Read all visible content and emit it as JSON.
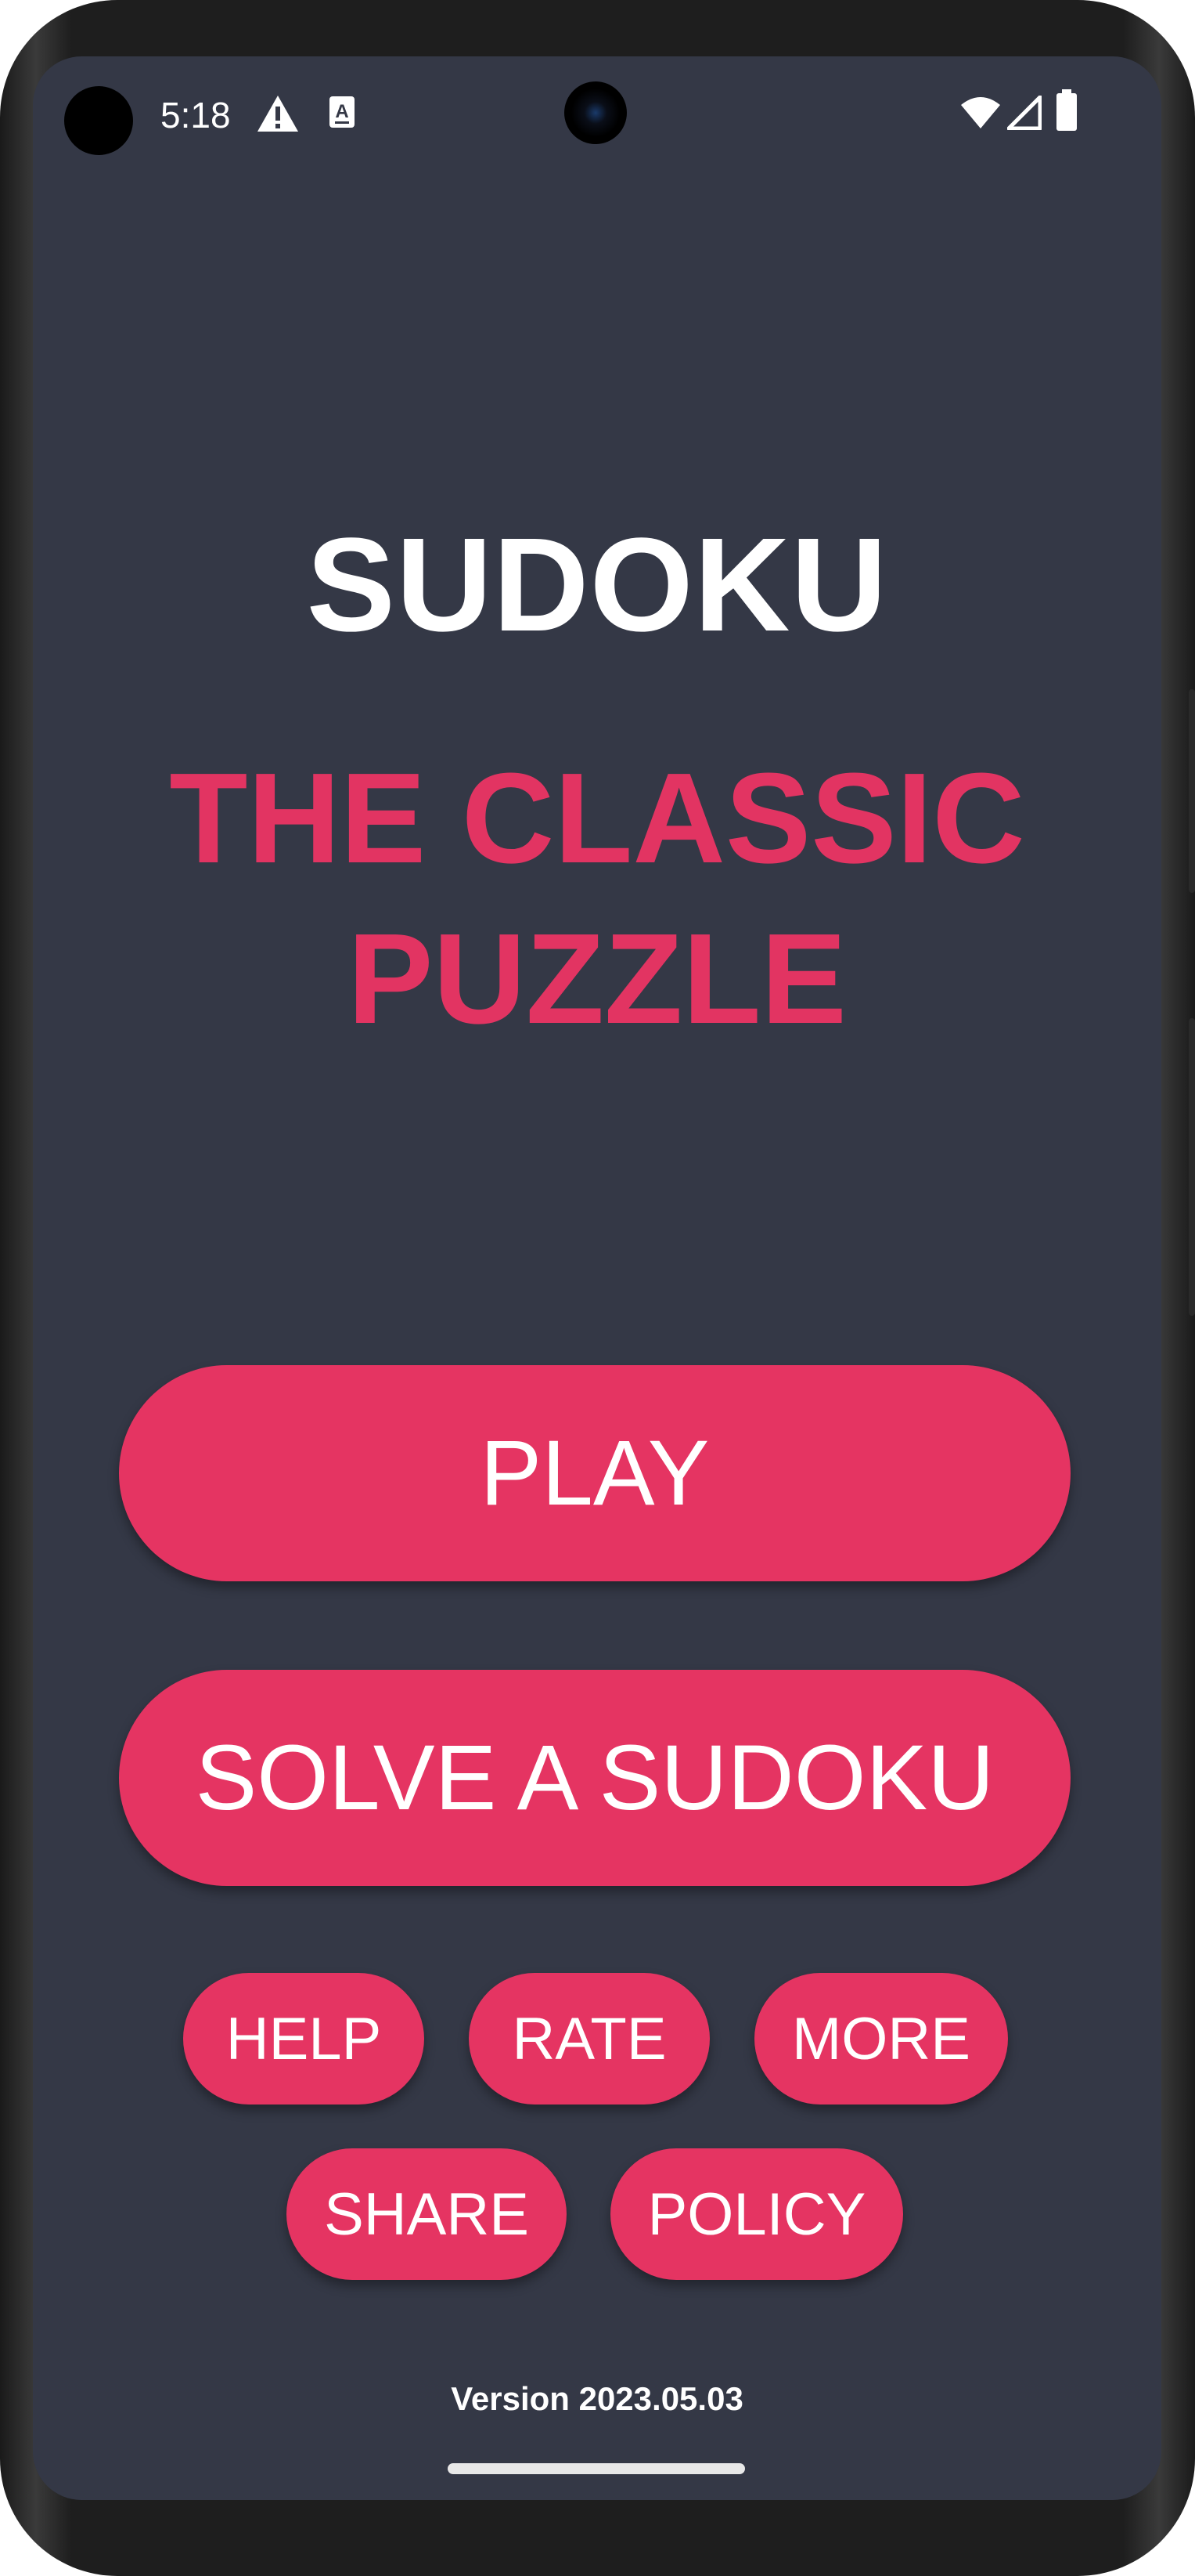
{
  "status_bar": {
    "time": "5:18",
    "icons": [
      "alert-triangle-icon",
      "text-a-icon",
      "wifi-icon",
      "signal-icon",
      "battery-icon"
    ]
  },
  "app": {
    "title": "SUDOKU",
    "subtitle_line1": "THE CLASSIC",
    "subtitle_line2": "PUZZLE",
    "version": "Version 2023.05.03"
  },
  "buttons": {
    "play": "PLAY",
    "solve": "SOLVE A SUDOKU",
    "help": "HELP",
    "rate": "RATE",
    "more": "MORE",
    "share": "SHARE",
    "policy": "POLICY"
  },
  "colors": {
    "background": "#343846",
    "accent": "#e53462",
    "text": "#ffffff"
  }
}
